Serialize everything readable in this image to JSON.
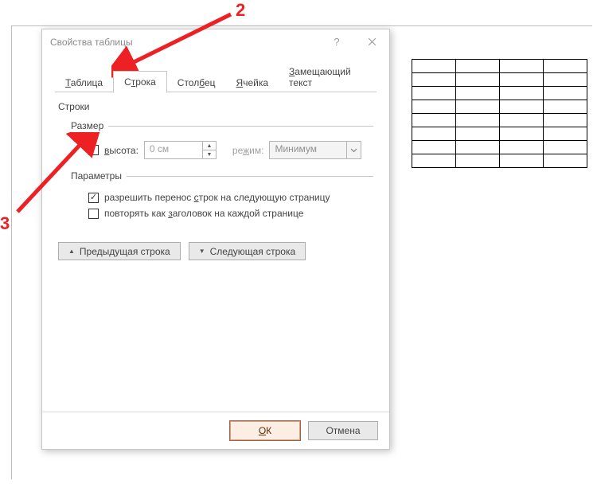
{
  "dialog": {
    "title": "Свойства таблицы",
    "help": "?",
    "tabs": {
      "table": {
        "pre": "",
        "u": "Т",
        "post": "аблица"
      },
      "row": {
        "pre": "С",
        "u": "т",
        "post": "рока"
      },
      "column": {
        "pre": "Стол",
        "u": "б",
        "post": "ец"
      },
      "cell": {
        "pre": "",
        "u": "Я",
        "post": "чейка"
      },
      "alt": {
        "pre": "",
        "u": "З",
        "post": "амещающий текст"
      }
    },
    "rows_label": "Строки",
    "size_legend": "Размер",
    "height": {
      "pre": "",
      "u": "в",
      "post": "ысота:"
    },
    "height_value": "0 см",
    "mode_label": {
      "pre": "ре",
      "u": "ж",
      "post": "им:"
    },
    "mode_value": "Минимум",
    "options_legend": {
      "pre": "",
      "u": "П",
      "post": "араметры"
    },
    "opt_allow": {
      "pre": "разрешить перенос ",
      "u": "с",
      "post": "трок на следующую страницу"
    },
    "opt_repeat": {
      "pre": "повторять как ",
      "u": "з",
      "post": "аголовок на каждой странице"
    },
    "prev_btn": {
      "pre": "Пре",
      "u": "д",
      "post": "ыдущая строка"
    },
    "next_btn": {
      "pre": "Следу",
      "u": "ю",
      "post": "щая строка"
    },
    "ok": {
      "pre": "",
      "u": "О",
      "post": "К"
    },
    "cancel": "Отмена"
  },
  "annotations": {
    "n2": "2",
    "n3": "3"
  }
}
